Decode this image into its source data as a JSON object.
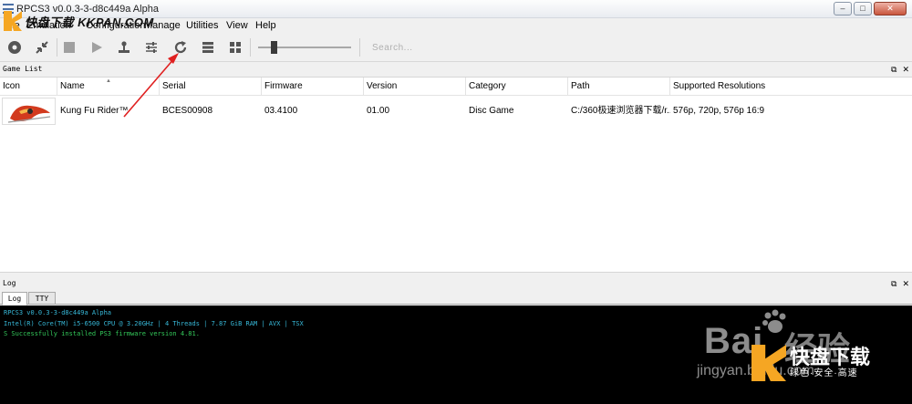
{
  "window": {
    "title": "RPCS3 v0.0.3-3-d8c449a Alpha",
    "controls": [
      "–",
      "□",
      "✕"
    ]
  },
  "watermark_top": {
    "text": "快盘下载 KKPAN.COM"
  },
  "menu": {
    "items": [
      "File",
      "Emulation",
      "Configuration",
      "Manage",
      "Utilities",
      "View",
      "Help"
    ]
  },
  "toolbar": {
    "buttons": [
      "boot",
      "fullscreen",
      "stop",
      "start",
      "pads",
      "config",
      "refresh",
      "list-view",
      "grid-view"
    ],
    "slider_value": 0.15,
    "search_placeholder": "Search..."
  },
  "gamelist": {
    "title": "Game List",
    "columns": [
      "Icon",
      "Name",
      "Serial",
      "Firmware",
      "Version",
      "Category",
      "Path",
      "Supported Resolutions"
    ],
    "rows": [
      {
        "name": "Kung Fu Rider™",
        "serial": "BCES00908",
        "firmware": "03.4100",
        "version": "01.00",
        "category": "Disc Game",
        "path": "C:/360极速浏览器下载/r...",
        "resolutions": "576p, 720p, 576p 16:9"
      }
    ]
  },
  "log": {
    "title": "Log",
    "tabs": [
      "Log",
      "TTY"
    ],
    "lines": [
      "RPCS3 v0.0.3-3-d8c449a Alpha",
      "Intel(R) Core(TM) i5-6500 CPU @ 3.20GHz | 4 Threads | 7.87 GiB RAM | AVX | TSX",
      "S Successfully installed PS3 firmware version 4.81."
    ]
  },
  "watermark_bottom": {
    "baidu": "Bai",
    "jingyan": "经验",
    "url": "jingyan.baidu.com",
    "kuaipan": "快盘下载",
    "kuaipan_sub": "绿色·安全·高速"
  },
  "colors": {
    "log_cyan": "#37b8d8",
    "log_green": "#33c85a",
    "annotation": "#e02020",
    "kuaipan_orange": "#f5a623"
  }
}
